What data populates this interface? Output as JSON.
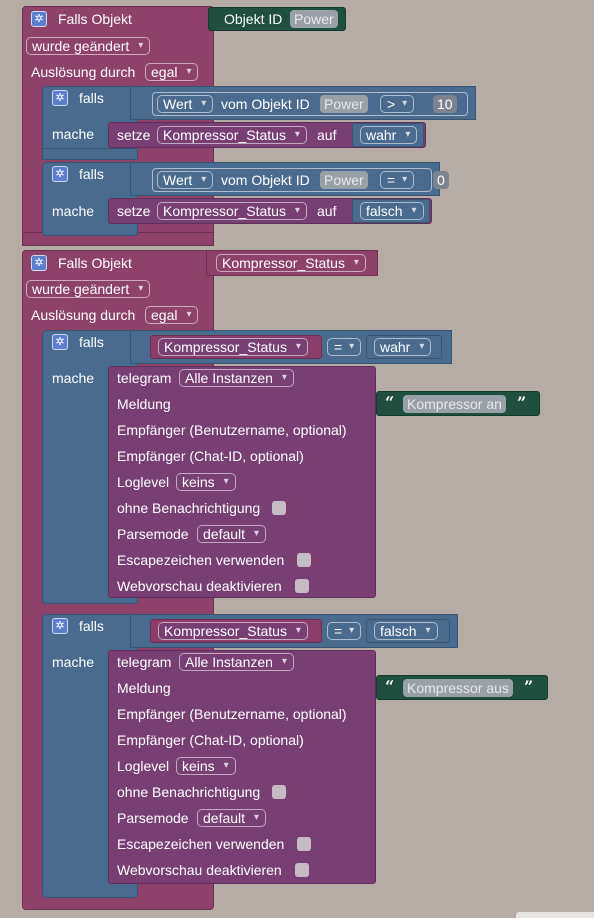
{
  "event1": {
    "title": "Falls Objekt",
    "object_label": "Objekt ID",
    "object_chip": "Power",
    "change": "wurde geändert",
    "trigger_label": "Auslösung durch",
    "trigger_value": "egal"
  },
  "if1": {
    "falls": "falls",
    "mache": "mache",
    "wert": "Wert",
    "vom_objekt": "vom Objekt ID",
    "chip": "Power",
    "op": ">",
    "num": "10",
    "setze": "setze",
    "var": "Kompressor_Status",
    "auf": "auf",
    "value": "wahr"
  },
  "if2": {
    "falls": "falls",
    "mache": "mache",
    "wert": "Wert",
    "vom_objekt": "vom Objekt ID",
    "chip": "Power",
    "op": "=",
    "num": "0",
    "setze": "setze",
    "var": "Kompressor_Status",
    "auf": "auf",
    "value": "falsch"
  },
  "event2": {
    "title": "Falls Objekt",
    "object_value": "Kompressor_Status",
    "change": "wurde geändert",
    "trigger_label": "Auslösung durch",
    "trigger_value": "egal"
  },
  "if3": {
    "falls": "falls",
    "mache": "mache",
    "var": "Kompressor_Status",
    "op": "=",
    "value": "wahr",
    "telegram": "telegram",
    "instances": "Alle Instanzen",
    "meldung": "Meldung",
    "message": "Kompressor an",
    "empf_user": "Empfänger (Benutzername, optional)",
    "empf_chat": "Empfänger (Chat-ID, optional)",
    "loglevel": "Loglevel",
    "loglevel_value": "keins",
    "silent": "ohne Benachrichtigung",
    "parsemode": "Parsemode",
    "parsemode_value": "default",
    "escape": "Escapezeichen verwenden",
    "preview": "Webvorschau deaktivieren"
  },
  "if4": {
    "falls": "falls",
    "mache": "mache",
    "var": "Kompressor_Status",
    "op": "=",
    "value": "falsch",
    "telegram": "telegram",
    "instances": "Alle Instanzen",
    "meldung": "Meldung",
    "message": "Kompressor aus",
    "empf_user": "Empfänger (Benutzername, optional)",
    "empf_chat": "Empfänger (Chat-ID, optional)",
    "loglevel": "Loglevel",
    "loglevel_value": "keins",
    "silent": "ohne Benachrichtigung",
    "parsemode": "Parsemode",
    "parsemode_value": "default",
    "escape": "Escapezeichen verwenden",
    "preview": "Webvorschau deaktivieren"
  },
  "icons": {
    "gear": "gear-icon",
    "quote_open": "“",
    "quote_close": "”"
  },
  "colors": {
    "workspace": "#b5ada5",
    "event_block": "#8e426a",
    "control_block": "#4a6b90",
    "action_block": "#7a3f72",
    "value_block": "#1f4f3e"
  }
}
